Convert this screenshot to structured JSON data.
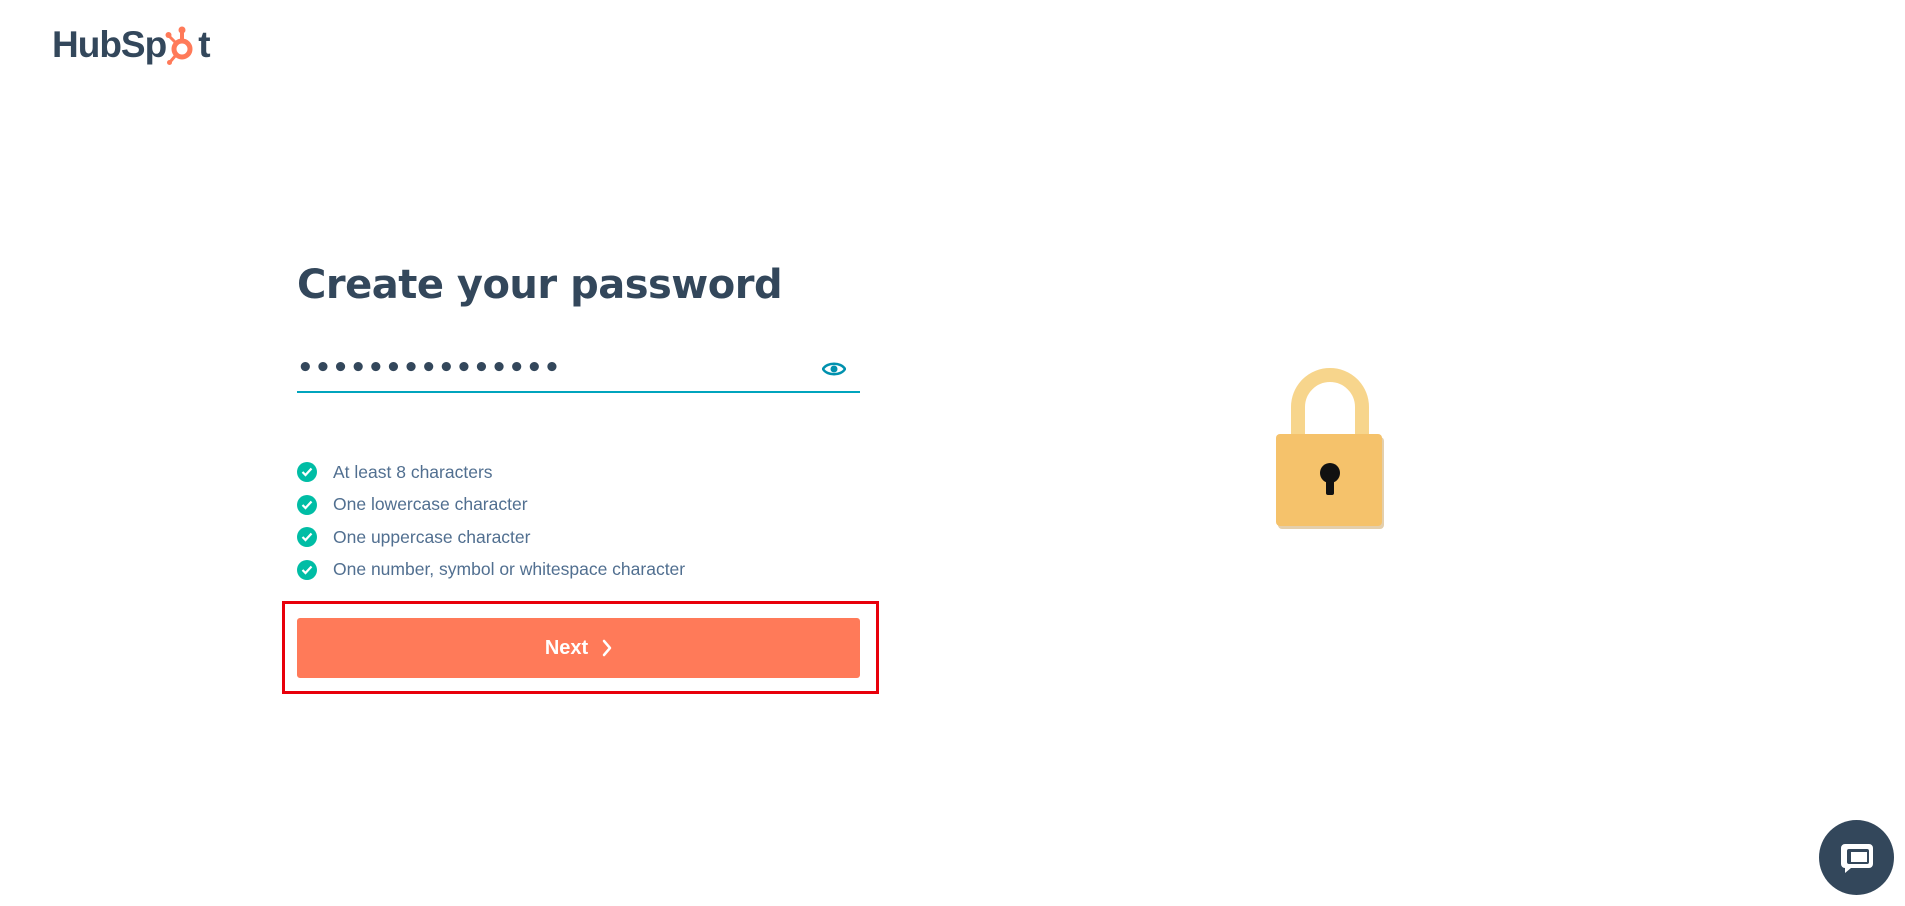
{
  "brand": {
    "logo_text_left": "HubSp",
    "logo_text_right": "t",
    "logo_color": "#33475b",
    "accent_color": "#ff7a59"
  },
  "form": {
    "heading": "Create your password",
    "password_value": "•••••••••••••••",
    "show_password_icon": "eye-icon",
    "rules": [
      {
        "label": "At least 8 characters",
        "met": true
      },
      {
        "label": "One lowercase character",
        "met": true
      },
      {
        "label": "One uppercase character",
        "met": true
      },
      {
        "label": "One number, symbol or whitespace character",
        "met": true
      }
    ],
    "next_label": "Next",
    "next_icon": "chevron-right-icon"
  },
  "illustration": {
    "icon": "padlock-icon",
    "body_color": "#f5c26b"
  },
  "chat": {
    "icon": "chat-bubbles-icon",
    "color": "#33475b"
  }
}
